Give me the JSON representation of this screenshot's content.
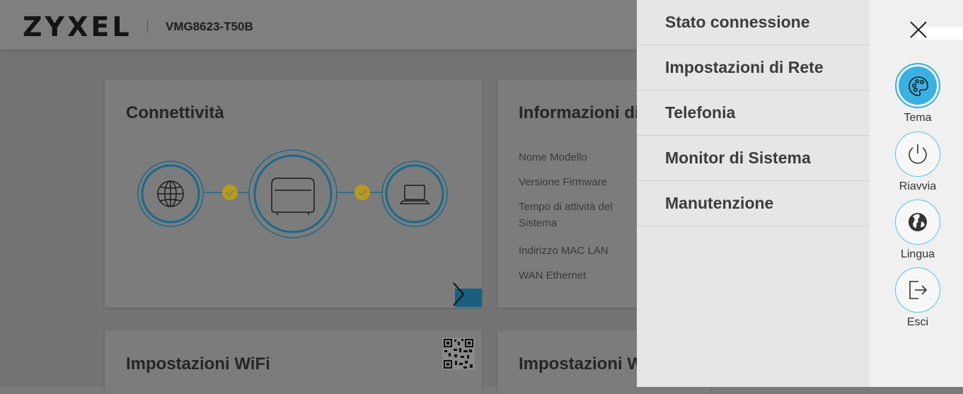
{
  "header": {
    "brand": "ZYXEL",
    "model": "VMG8623-T50B"
  },
  "cards": {
    "connectivity": {
      "title": "Connettività"
    },
    "device_info": {
      "title": "Informazioni di",
      "labels": [
        "Nome Modello",
        "Versione Firmware",
        "Tempo di attività del",
        "Sistema",
        "Indirizzo MAC LAN",
        "WAN Ethernet"
      ]
    },
    "wifi": {
      "title": "Impostazioni WiFi"
    },
    "wifi2": {
      "title": "Impostazioni W"
    }
  },
  "menu": {
    "items": [
      {
        "label": "Stato connessione"
      },
      {
        "label": "Impostazioni di Rete"
      },
      {
        "label": "Telefonia"
      },
      {
        "label": "Monitor di Sistema"
      },
      {
        "label": "Manutenzione"
      }
    ]
  },
  "side_actions": [
    {
      "label": "Tema",
      "icon": "palette-icon"
    },
    {
      "label": "Riavvia",
      "icon": "power-icon"
    },
    {
      "label": "Lingua",
      "icon": "globe-icon"
    },
    {
      "label": "Esci",
      "icon": "logout-icon"
    }
  ],
  "colors": {
    "accent": "#3ab1e2",
    "ring": "#1a6a8c",
    "check": "#b99a1e"
  }
}
